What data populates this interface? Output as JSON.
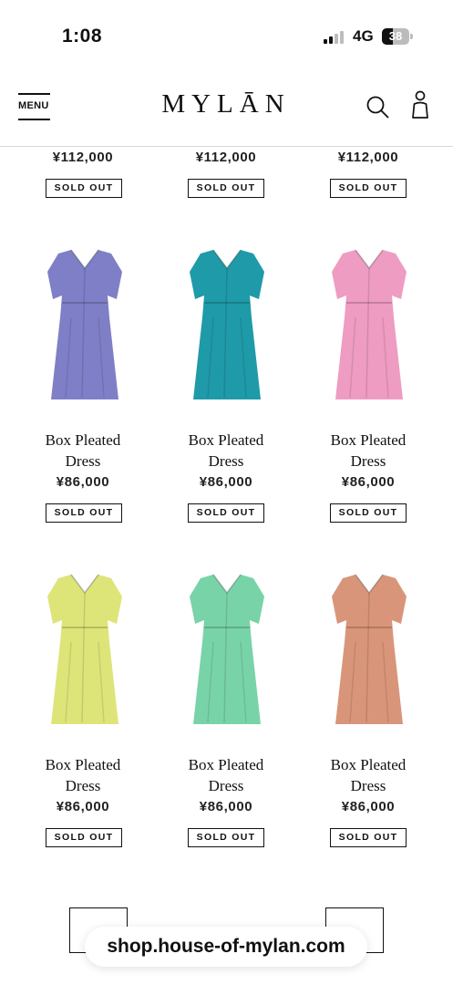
{
  "status_bar": {
    "time": "1:08",
    "network": "4G",
    "battery": "38"
  },
  "header": {
    "menu_label": "MENU",
    "logo": "MYLĀN"
  },
  "colors": {
    "accent": "#111111",
    "divider": "#d6d6d6"
  },
  "top_row": [
    {
      "price": "¥112,000",
      "status": "SOLD OUT"
    },
    {
      "price": "¥112,000",
      "status": "SOLD OUT"
    },
    {
      "price": "¥112,000",
      "status": "SOLD OUT"
    }
  ],
  "products": [
    {
      "name_line1": "Box Pleated",
      "name_line2": "Dress",
      "price": "¥86,000",
      "status": "SOLD OUT",
      "color": "#7f7fc7"
    },
    {
      "name_line1": "Box Pleated",
      "name_line2": "Dress",
      "price": "¥86,000",
      "status": "SOLD OUT",
      "color": "#1f9aa8"
    },
    {
      "name_line1": "Box Pleated",
      "name_line2": "Dress",
      "price": "¥86,000",
      "status": "SOLD OUT",
      "color": "#ee9cc1"
    },
    {
      "name_line1": "Box Pleated",
      "name_line2": "Dress",
      "price": "¥86,000",
      "status": "SOLD OUT",
      "color": "#dde579"
    },
    {
      "name_line1": "Box Pleated",
      "name_line2": "Dress",
      "price": "¥86,000",
      "status": "SOLD OUT",
      "color": "#79d3a8"
    },
    {
      "name_line1": "Box Pleated",
      "name_line2": "Dress",
      "price": "¥86,000",
      "status": "SOLD OUT",
      "color": "#d99579"
    }
  ],
  "pagination": {
    "prev_icon": "arrow-left-icon",
    "next_icon": "arrow-right-icon",
    "prev_glyph": "←",
    "next_glyph": "→"
  },
  "browser": {
    "url": "shop.house-of-mylan.com"
  }
}
